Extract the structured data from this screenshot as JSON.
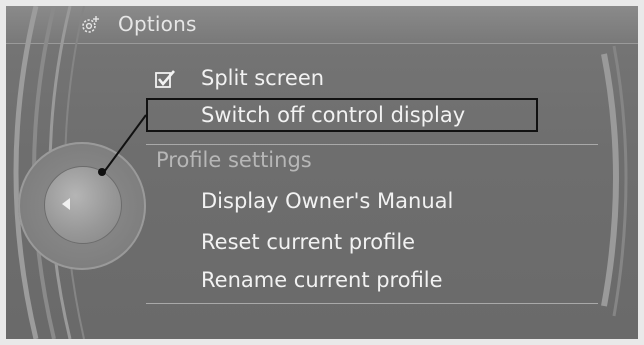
{
  "header": {
    "title": "Options",
    "icon": "gear-icon"
  },
  "menu": {
    "items": [
      {
        "label": "Split screen",
        "checked": true
      },
      {
        "label": "Switch off control display",
        "selected": true
      },
      {
        "label": "Profile settings",
        "section": true
      },
      {
        "label": "Display Owner's Manual"
      },
      {
        "label": "Reset current profile"
      },
      {
        "label": "Rename current profile"
      }
    ]
  },
  "controller": {
    "icon": "left-arrow-icon"
  },
  "colors": {
    "background": "#6e6e6e",
    "text": "#f2f2f2",
    "section_text": "#b7b7b7",
    "highlight_border": "#111111"
  }
}
